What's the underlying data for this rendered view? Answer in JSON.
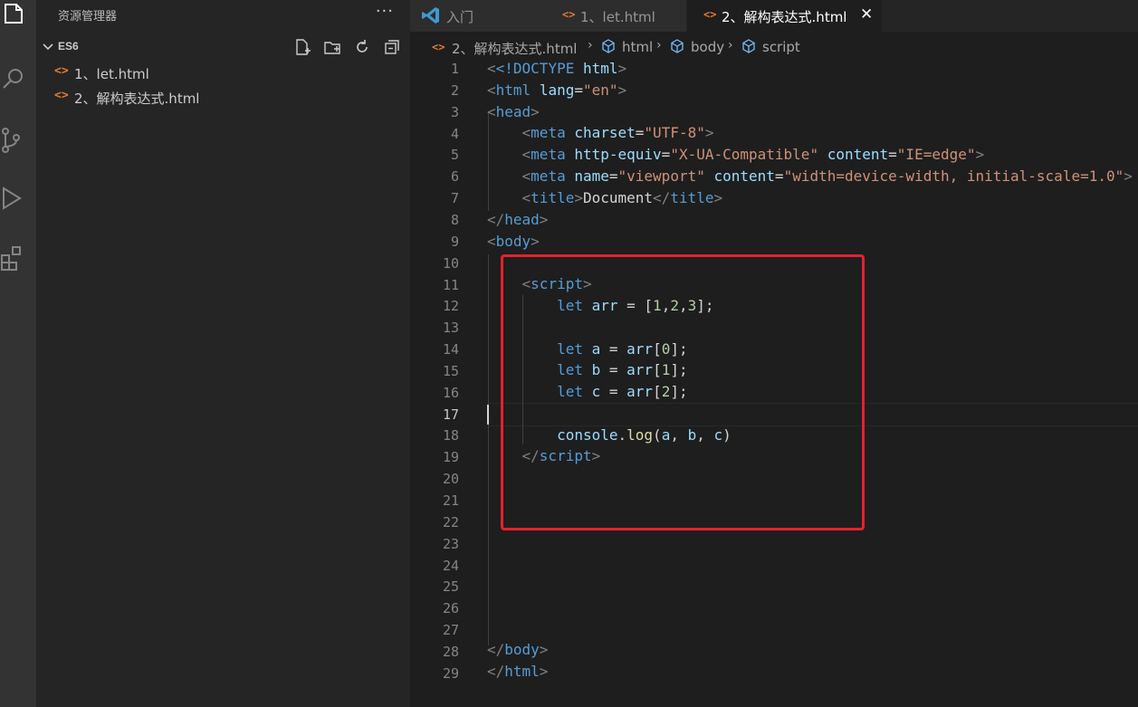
{
  "sidebar": {
    "title": "资源管理器",
    "more": "···",
    "folder": "ES6",
    "files": [
      {
        "icon": "<>",
        "name": "1、let.html"
      },
      {
        "icon": "<>",
        "name": "2、解构表达式.html"
      }
    ]
  },
  "tabs": [
    {
      "label": "入门",
      "icon": "vscode-logo-icon"
    },
    {
      "label": "1、let.html",
      "icon": "<>"
    },
    {
      "label": "2、解构表达式.html",
      "icon": "<>",
      "active": true
    }
  ],
  "breadcrumb": {
    "file": "2、解构表达式.html",
    "items": [
      "html",
      "body",
      "script"
    ]
  },
  "editor": {
    "current_line": 17,
    "line_numbers": [
      "1",
      "2",
      "3",
      "4",
      "5",
      "6",
      "7",
      "8",
      "9",
      "10",
      "11",
      "12",
      "13",
      "14",
      "15",
      "16",
      "17",
      "18",
      "19",
      "20",
      "21",
      "22",
      "23",
      "24",
      "25",
      "26",
      "27",
      "28",
      "29"
    ],
    "tokens": {
      "doctype": "<!DOCTYPE",
      "html": "html",
      "lang": "lang",
      "en": "\"en\"",
      "head": "head",
      "meta": "meta",
      "charset": "charset",
      "utf8": "\"UTF-8\"",
      "http_equiv": "http-equiv",
      "xua": "\"X-UA-Compatible\"",
      "content": "content",
      "ieedge": "\"IE=edge\"",
      "name": "name",
      "viewport": "\"viewport\"",
      "vp_content": "\"width=device-width, initial-scale=1.0\"",
      "title": "title",
      "document": "Document",
      "body": "body",
      "script": "script",
      "let": "let",
      "arr": "arr",
      "nums": [
        "1",
        "2",
        "3"
      ],
      "a": "a",
      "b": "b",
      "c": "c",
      "idx": [
        "0",
        "1",
        "2"
      ],
      "console": "console",
      "log": "log"
    }
  },
  "colors": {
    "highlight_box": "#e8202a",
    "html_icon": "#e37933",
    "vscode_logo": "#3c99d4"
  }
}
